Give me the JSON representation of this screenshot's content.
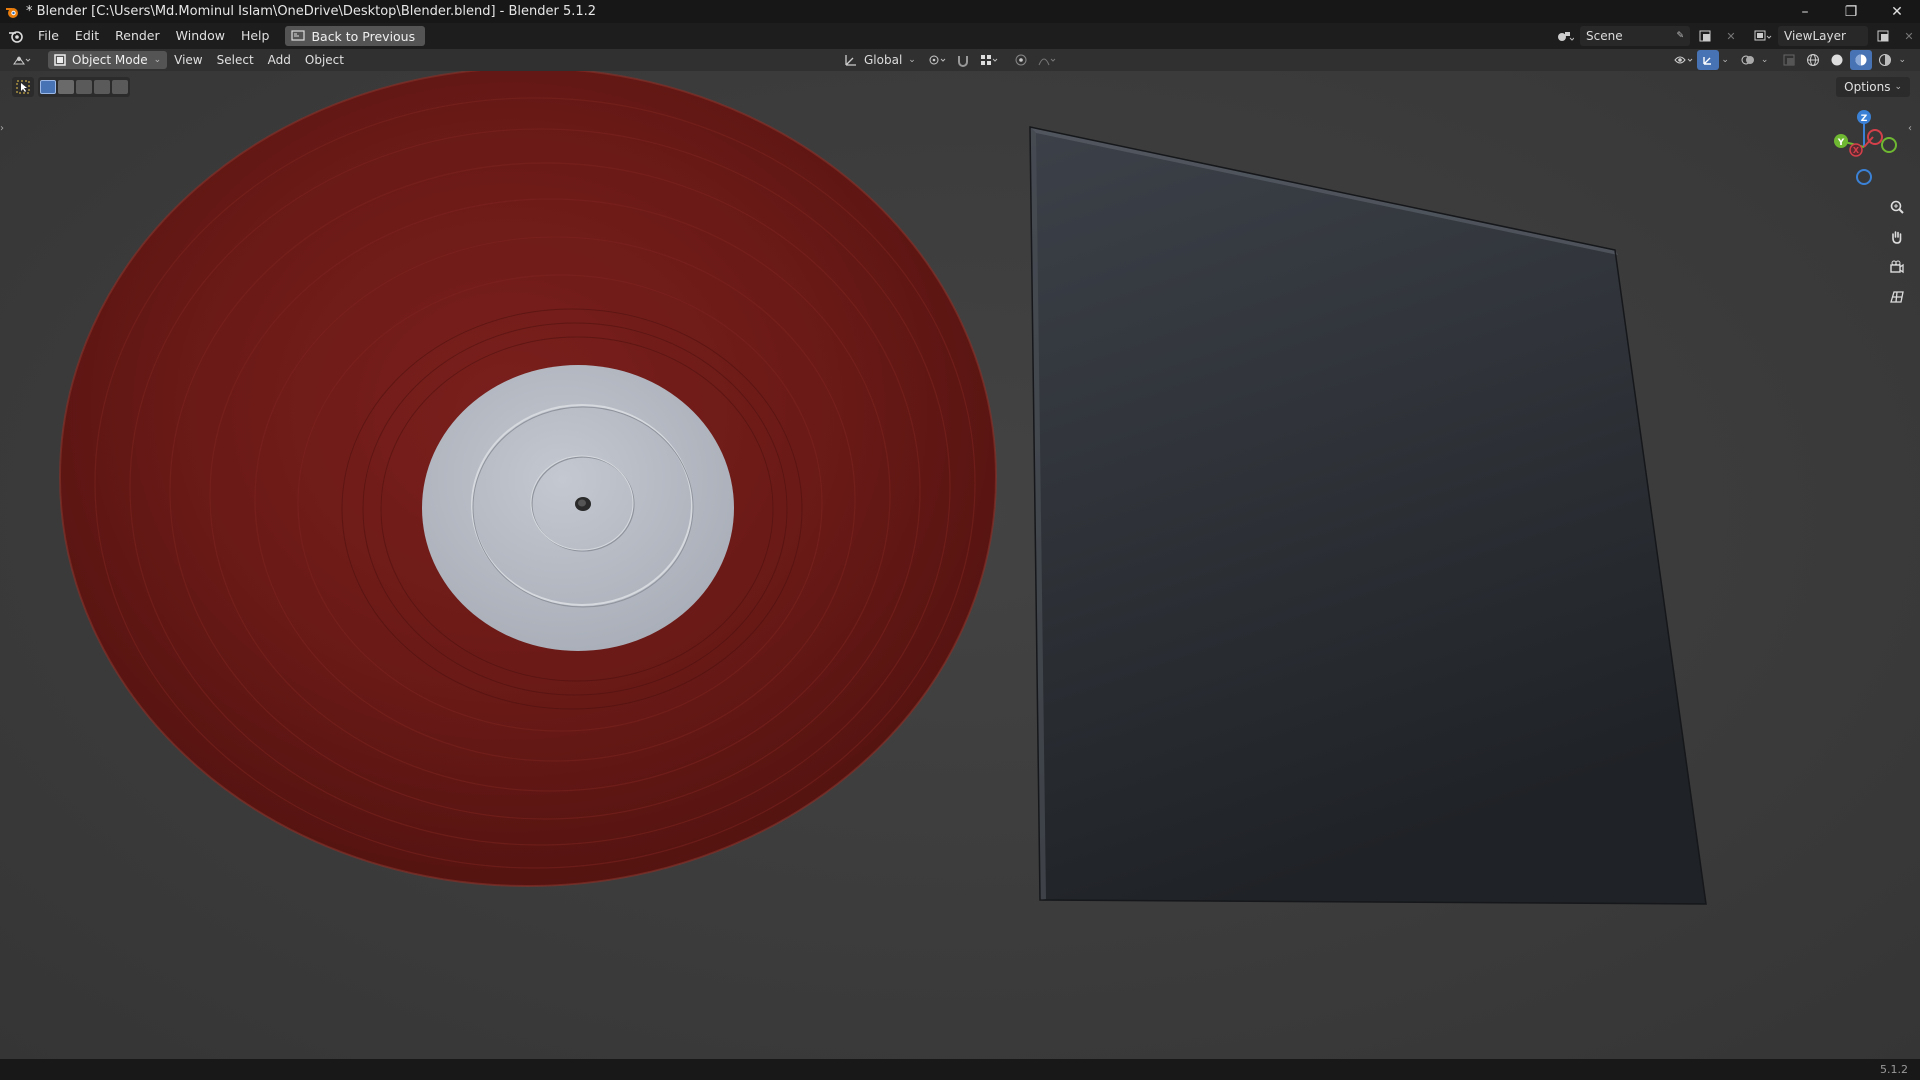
{
  "window": {
    "title": "* Blender [C:\\Users\\Md.Mominul Islam\\OneDrive\\Desktop\\Blender.blend] - Blender 5.1.2",
    "minimize_glyph": "–",
    "maximize_glyph": "❐",
    "close_glyph": "✕"
  },
  "topbar": {
    "menus": [
      "File",
      "Edit",
      "Render",
      "Window",
      "Help"
    ],
    "back_button": "Back to Previous",
    "scene": "Scene",
    "view_layer": "ViewLayer"
  },
  "header": {
    "mode": "Object Mode",
    "menus": [
      "View",
      "Select",
      "Add",
      "Object"
    ],
    "transform_orientation": "Global"
  },
  "viewport": {
    "options_label": "Options",
    "gizmo_axes": {
      "z": "Z",
      "y": "Y",
      "x": "X"
    },
    "objects": [
      "vinyl-record",
      "record-sleeve"
    ],
    "colors": {
      "record": "#6b1a17",
      "label": "#b7bcc6",
      "sleeve": "#2c2f34",
      "axis_x": "#d4404a",
      "axis_y": "#6fb832",
      "axis_z": "#3b82d6"
    }
  },
  "status": {
    "version": "5.1.2"
  }
}
